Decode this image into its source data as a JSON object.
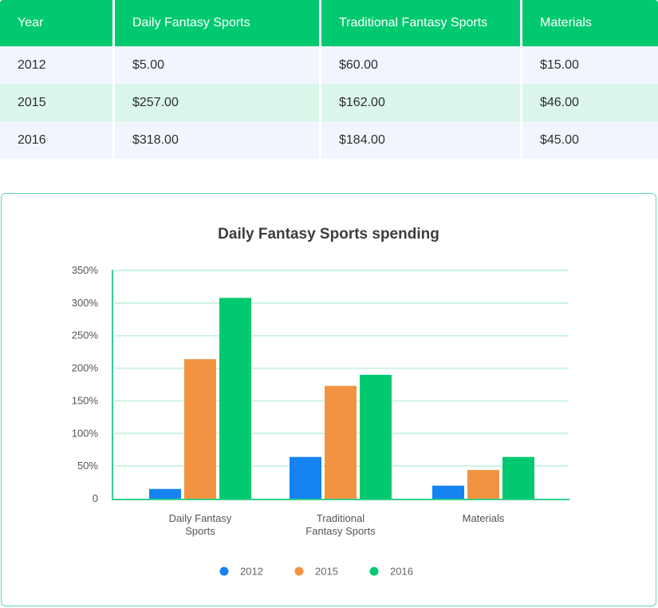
{
  "table": {
    "headers": [
      "Year",
      "Daily Fantasy Sports",
      "Traditional Fantasy Sports",
      "Materials"
    ],
    "rows": [
      [
        "2012",
        "$5.00",
        "$60.00",
        "$15.00"
      ],
      [
        "2015",
        "$257.00",
        "$162.00",
        "$46.00"
      ],
      [
        "2016",
        "$318.00",
        "$184.00",
        "$45.00"
      ]
    ]
  },
  "colors": {
    "header_bg": "#00c96f",
    "row_bg": "#f1f6fe",
    "row_alt_bg": "#dbf6ea",
    "s2012": "#1583f2",
    "s2015": "#f29341",
    "s2016": "#00c96f",
    "grid": "#cdf3e2",
    "axis": "#33d08d"
  },
  "chart_data": {
    "type": "bar",
    "title": "Daily Fantasy Sports spending",
    "xlabel": "",
    "ylabel": "",
    "categories": [
      [
        "Daily Fantasy",
        "Sports"
      ],
      [
        "Traditional",
        "Fantasy Sports"
      ],
      [
        "Materials"
      ]
    ],
    "series": [
      {
        "name": "2012",
        "color": "#1583f2",
        "values": [
          15,
          64,
          20
        ]
      },
      {
        "name": "2015",
        "color": "#f29341",
        "values": [
          214,
          173,
          44
        ]
      },
      {
        "name": "2016",
        "color": "#00c96f",
        "values": [
          308,
          190,
          64
        ]
      }
    ],
    "ylim": [
      0,
      350
    ],
    "yticks": [
      0,
      50,
      100,
      150,
      200,
      250,
      300,
      350
    ],
    "ytick_labels": [
      "0",
      "50%",
      "100%",
      "150%",
      "200%",
      "250%",
      "300%",
      "350%"
    ],
    "grid": true,
    "legend_position": "bottom-center"
  }
}
